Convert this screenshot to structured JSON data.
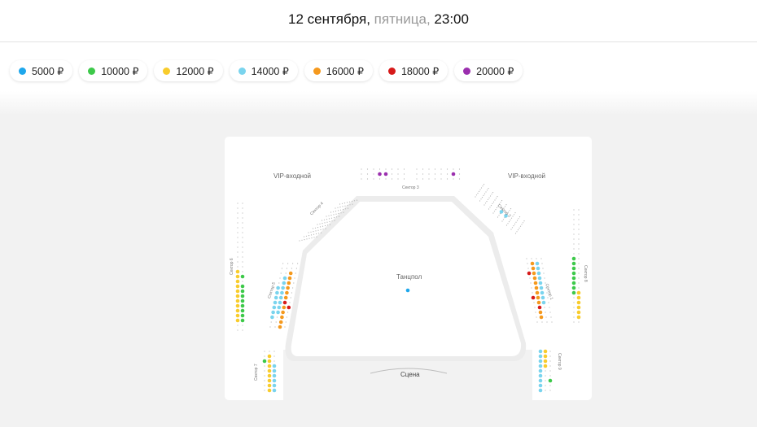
{
  "header": {
    "date_main": "12 сентября,",
    "weekday": "пятница,",
    "time": "23:00"
  },
  "legend": [
    {
      "label": "5000 ₽",
      "color": "#1ea7ec"
    },
    {
      "label": "10000 ₽",
      "color": "#3dc94a"
    },
    {
      "label": "12000 ₽",
      "color": "#f8cc2c"
    },
    {
      "label": "14000 ₽",
      "color": "#7ad4ee"
    },
    {
      "label": "16000 ₽",
      "color": "#f5991d"
    },
    {
      "label": "18000 ₽",
      "color": "#d61a1a"
    },
    {
      "label": "20000 ₽",
      "color": "#9b2fae"
    }
  ],
  "hall": {
    "vip_left": "VIP-входной",
    "vip_right": "VIP-входной",
    "dance_floor": "Танцпол",
    "stage": "Сцена",
    "sector_center": "Сектор 3",
    "sector_left_top": "Сектор 4",
    "sector_right_top": "Сектор 2",
    "sector_left_mid": "Сектор 5",
    "sector_right_mid": "Сектор 1",
    "sector_left_far": "Сектор 6",
    "sector_right_far": "Сектор 8",
    "sector_left_bottom": "Сектор 7",
    "sector_right_bottom": "Сектор 9"
  }
}
